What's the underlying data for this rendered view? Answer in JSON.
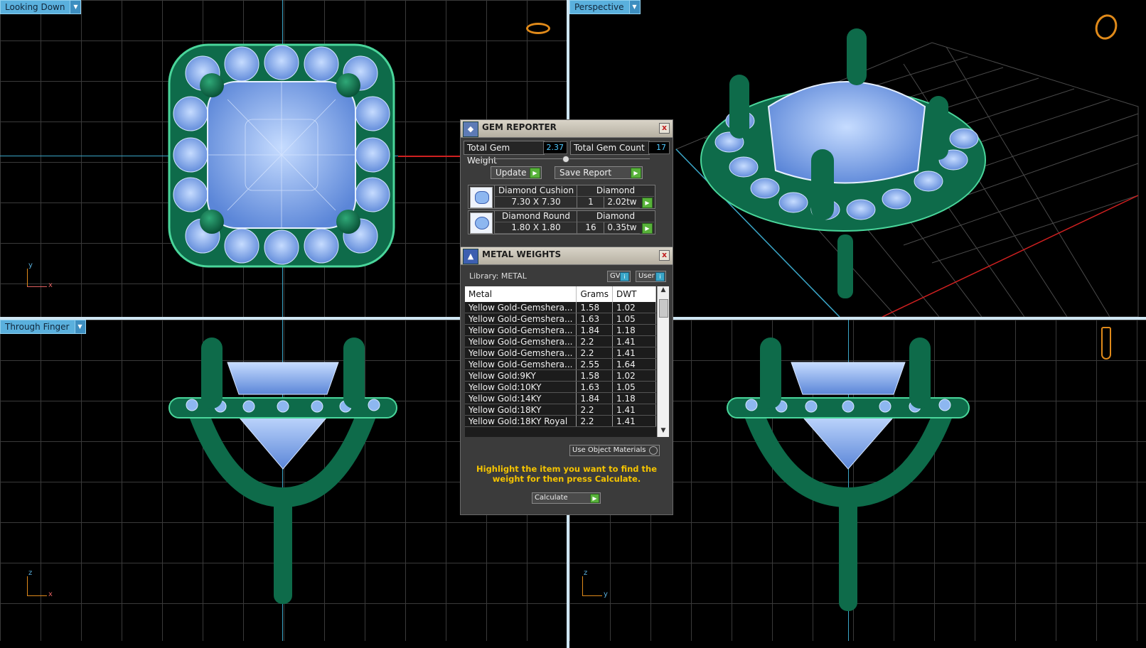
{
  "viewports": {
    "top_left": {
      "label": "Looking Down",
      "axes": {
        "a": "y",
        "b": "x"
      }
    },
    "top_right": {
      "label": "Perspective"
    },
    "bottom_left": {
      "label": "Through Finger",
      "axes": {
        "a": "z",
        "b": "x"
      }
    },
    "bottom_right": {
      "axes": {
        "a": "z",
        "b": "y"
      }
    }
  },
  "gem_reporter": {
    "title": "GEM REPORTER",
    "close": "x",
    "total_gem_weight_label": "Total Gem Weight",
    "total_gem_weight": "2.37",
    "total_gem_count_label": "Total Gem Count",
    "total_gem_count": "17",
    "update_label": "Update",
    "save_report_label": "Save Report",
    "gems": [
      {
        "name": "Diamond Cushion",
        "material": "Diamond",
        "size": "7.30 X 7.30",
        "count": "1",
        "weight": "2.02tw"
      },
      {
        "name": "Diamond Round",
        "material": "Diamond",
        "size": "1.80 X 1.80",
        "count": "16",
        "weight": "0.35tw"
      }
    ]
  },
  "metal_weights": {
    "title": "METAL WEIGHTS",
    "close": "x",
    "library": "Library: METAL",
    "gv_label": "GV",
    "user_label": "User",
    "columns": [
      "Metal",
      "Grams",
      "DWT"
    ],
    "rows": [
      {
        "metal": "Yellow Gold-Gemshera...",
        "grams": "1.58",
        "dwt": "1.02"
      },
      {
        "metal": "Yellow Gold-Gemshera...",
        "grams": "1.63",
        "dwt": "1.05"
      },
      {
        "metal": "Yellow Gold-Gemshera...",
        "grams": "1.84",
        "dwt": "1.18"
      },
      {
        "metal": "Yellow Gold-Gemshera...",
        "grams": "2.2",
        "dwt": "1.41"
      },
      {
        "metal": "Yellow Gold-Gemshera...",
        "grams": "2.2",
        "dwt": "1.41"
      },
      {
        "metal": "Yellow Gold-Gemshera...",
        "grams": "2.55",
        "dwt": "1.64"
      },
      {
        "metal": "Yellow Gold:9KY",
        "grams": "1.58",
        "dwt": "1.02"
      },
      {
        "metal": "Yellow Gold:10KY",
        "grams": "1.63",
        "dwt": "1.05"
      },
      {
        "metal": "Yellow Gold:14KY",
        "grams": "1.84",
        "dwt": "1.18"
      },
      {
        "metal": "Yellow Gold:18KY",
        "grams": "2.2",
        "dwt": "1.41"
      },
      {
        "metal": "Yellow Gold:18KY Royal",
        "grams": "2.2",
        "dwt": "1.41"
      }
    ],
    "use_object_materials": "Use Object Materials",
    "hint": "Highlight the item you want to find the weight for then press Calculate.",
    "calculate_label": "Calculate"
  },
  "colors": {
    "metal": "#0e6b4a",
    "gem": "#8db7f0",
    "accent": "#5ab0dd",
    "hint": "#f5c400"
  },
  "icons": [
    "ring-top-view-icon",
    "ring-perspective-icon",
    "ring-side-view-icon",
    "gem-reporter-icon",
    "metal-weights-icon"
  ]
}
